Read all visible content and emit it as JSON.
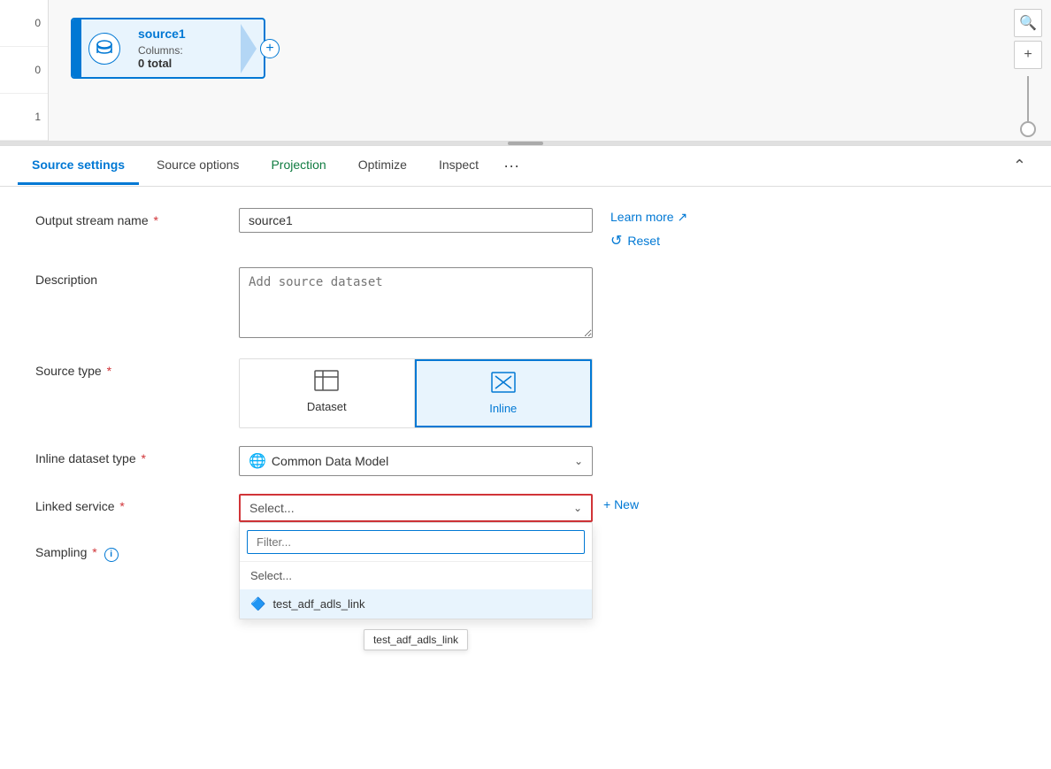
{
  "topCanvas": {
    "rulerNumbers": [
      "0",
      "0",
      "1"
    ],
    "sourceNode": {
      "title": "source1",
      "columnsLabel": "Columns:",
      "columnsCount": "0 total",
      "plusIcon": "+"
    }
  },
  "tabs": {
    "items": [
      {
        "id": "source-settings",
        "label": "Source settings",
        "active": true
      },
      {
        "id": "source-options",
        "label": "Source options",
        "active": false
      },
      {
        "id": "projection",
        "label": "Projection",
        "active": false
      },
      {
        "id": "optimize",
        "label": "Optimize",
        "active": false
      },
      {
        "id": "inspect",
        "label": "Inspect",
        "active": false
      }
    ],
    "moreIcon": "···",
    "collapseIcon": "⌃"
  },
  "form": {
    "outputStreamName": {
      "label": "Output stream name",
      "required": true,
      "value": "source1"
    },
    "description": {
      "label": "Description",
      "placeholder": "Add source dataset"
    },
    "sourceType": {
      "label": "Source type",
      "required": true,
      "options": [
        {
          "id": "dataset",
          "label": "Dataset",
          "icon": "⊞"
        },
        {
          "id": "inline",
          "label": "Inline",
          "icon": "⊠",
          "active": true
        }
      ]
    },
    "inlineDatasetType": {
      "label": "Inline dataset type",
      "required": true,
      "value": "Common Data Model",
      "icon": "🌐"
    },
    "linkedService": {
      "label": "Linked service",
      "required": true,
      "placeholder": "Select...",
      "chevron": "⌄",
      "filterPlaceholder": "Filter...",
      "options": [
        {
          "id": "select",
          "label": "Select..."
        },
        {
          "id": "test_link",
          "label": "test_adf_adls_link",
          "icon": "🔷"
        }
      ],
      "tooltip": "test_adf_adls_link"
    },
    "sampling": {
      "label": "Sampling",
      "required": true,
      "hasInfo": true
    },
    "newButton": "+ New",
    "learnMore": "Learn more ↗",
    "reset": "Reset"
  },
  "icons": {
    "search": "🔍",
    "plus": "+",
    "zoomHandle": "○"
  }
}
